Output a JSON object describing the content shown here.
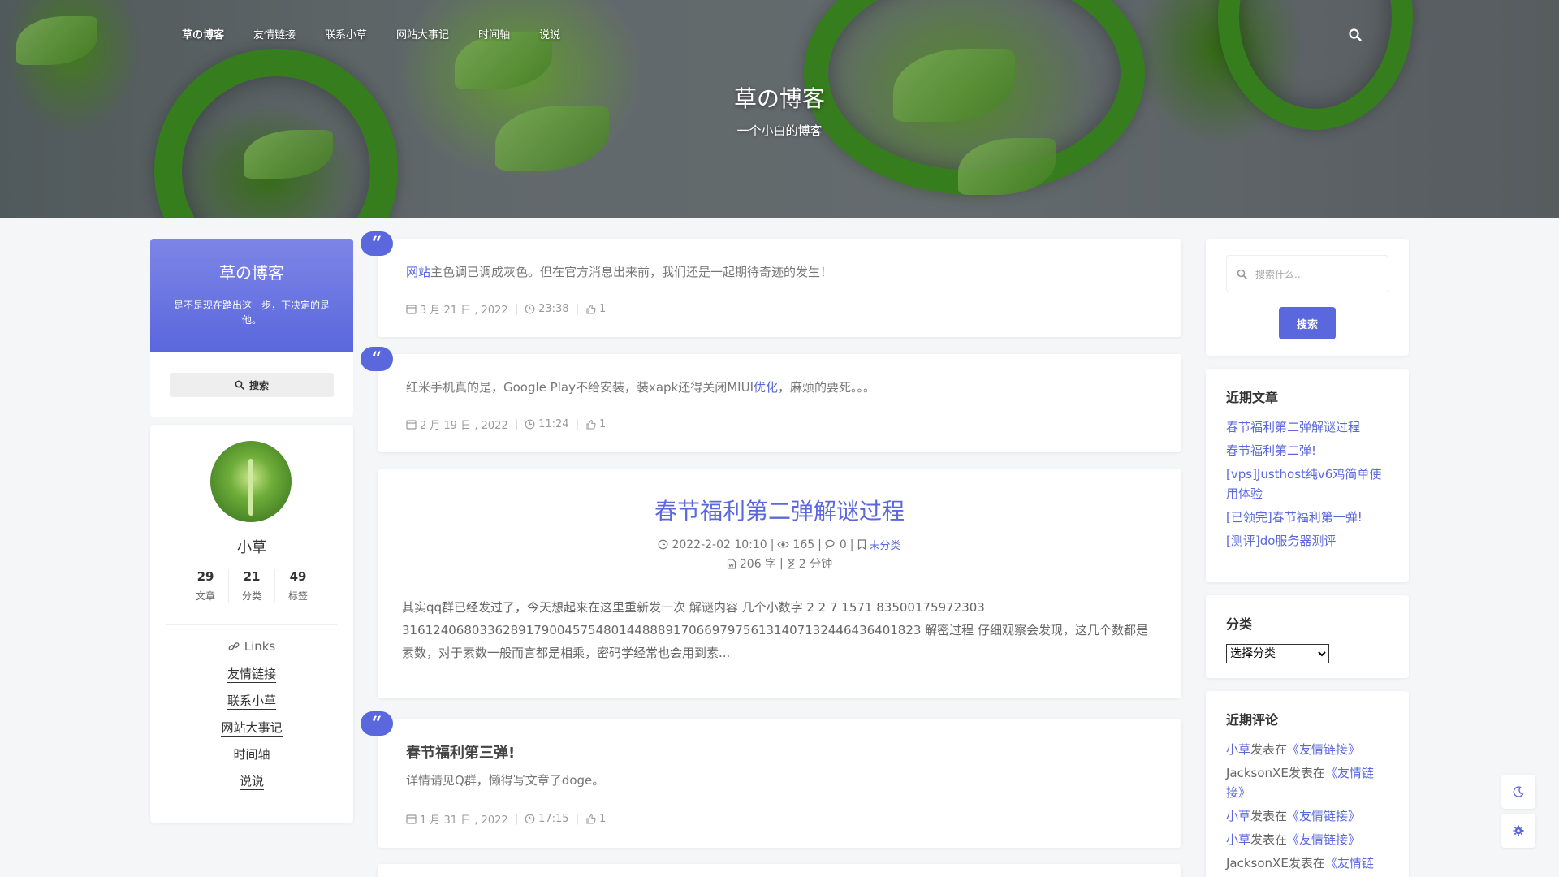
{
  "nav": {
    "items": [
      "草の博客",
      "友情链接",
      "联系小草",
      "网站大事记",
      "时间轴",
      "说说"
    ],
    "search_icon": "search-icon"
  },
  "hero": {
    "title": "草の博客",
    "subtitle": "一个小白的博客"
  },
  "left": {
    "header_title": "草の博客",
    "header_desc": "是不是现在踏出这一步，下决定的是他。",
    "search_label": "搜索",
    "profile_name": "小草",
    "stats": [
      {
        "num": "29",
        "label": "文章"
      },
      {
        "num": "21",
        "label": "分类"
      },
      {
        "num": "49",
        "label": "标签"
      }
    ],
    "links_title": "Links",
    "links": [
      "友情链接",
      "联系小草",
      "网站大事记",
      "时间轴",
      "说说"
    ]
  },
  "posts": {
    "p1": {
      "highlight": "网站",
      "text": "主色调已调成灰色。但在官方消息出来前，我们还是一起期待奇迹的发生！",
      "date": "3 月 21 日 , 2022",
      "time": "23:38",
      "likes": "1"
    },
    "p2": {
      "text_a": "红米手机真的是，Google Play不给安装，装xapk还得关闭MIUI",
      "highlight": "优化",
      "text_b": "，麻烦的要死。。。",
      "date": "2 月 19 日 , 2022",
      "time": "11:24",
      "likes": "1"
    },
    "p3": {
      "title": "春节福利第二弹解谜过程",
      "datetime": "2022-2-02 10:10",
      "views": "165",
      "comments": "0",
      "category": "未分类",
      "words": "206 字",
      "read_time": "2 分钟",
      "excerpt": "其实qq群已经发过了，今天想起来在这里重新发一次 解谜内容 几个小数字 2 2 7 1571 83500175972303 3161240680336289179004575480144888917066979756131407132446436401823 解密过程 仔细观察会发现，这几个数都是素数，对于素数一般而言都是相乘，密码学经常也会用到素..."
    },
    "p4": {
      "title": "春节福利第三弹!",
      "text": "详情请见Q群，懒得写文章了doge。",
      "date": "1 月 31 日 , 2022",
      "time": "17:15",
      "likes": "1"
    }
  },
  "right": {
    "search_placeholder": "搜索什么...",
    "search_button": "搜索",
    "recent_title": "近期文章",
    "recent": [
      "春节福利第二弹解谜过程",
      "春节福利第二弹!",
      "[vps]Justhost纯v6鸡简单使用体验",
      "[已领完]春节福利第一弹!",
      "[测评]do服务器测评"
    ],
    "category_title": "分类",
    "category_select": "选择分类",
    "comments_title": "近期评论",
    "comments": [
      {
        "user": "小草",
        "mid": "发表在",
        "link": "《友情链接》"
      },
      {
        "user": "JacksonXE",
        "mid": "发表在",
        "link": "《友情链接》"
      },
      {
        "user": "小草",
        "mid": "发表在",
        "link": "《友情链接》"
      },
      {
        "user": "小草",
        "mid": "发表在",
        "link": "《友情链接》"
      },
      {
        "user": "JacksonXE",
        "mid": "发表在",
        "link": "《友情链"
      }
    ]
  },
  "colors": {
    "accent": "#5a67dd",
    "background": "#f5f6f8"
  }
}
